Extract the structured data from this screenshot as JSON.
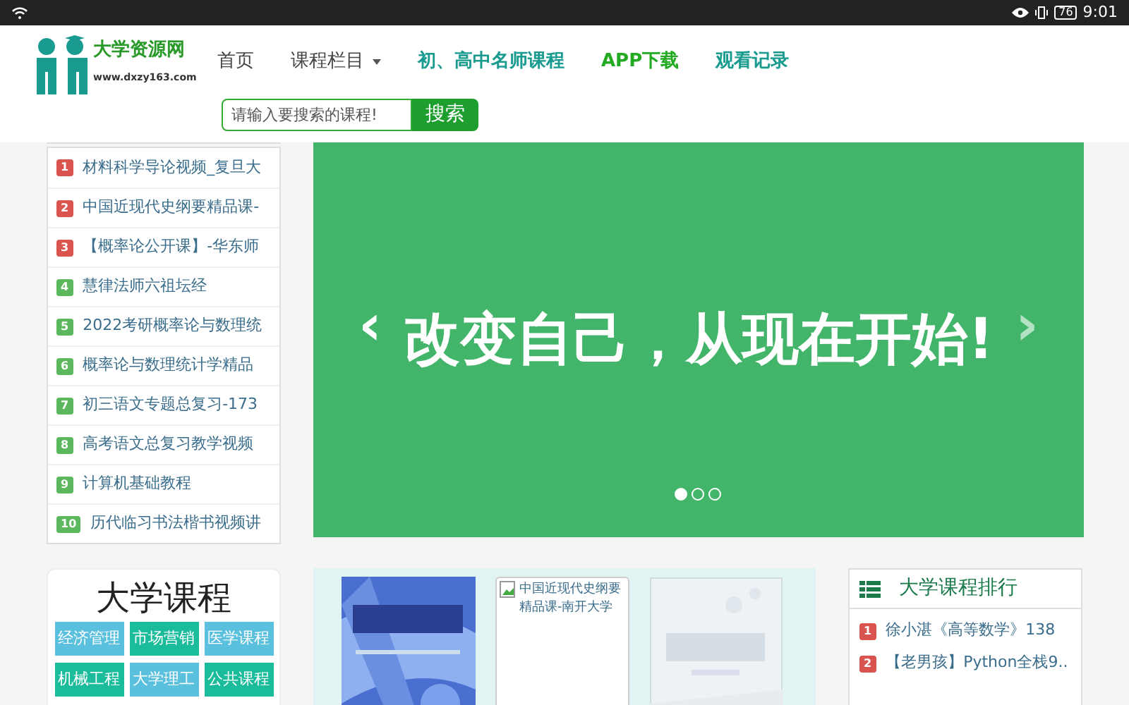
{
  "status_bar": {
    "time": "9:01",
    "battery": "76"
  },
  "site": {
    "name": "大学资源网",
    "url": "www.dxzy163.com"
  },
  "nav": [
    {
      "label": "首页",
      "kind": "plain",
      "dropdown": false
    },
    {
      "label": "课程栏目",
      "kind": "plain",
      "dropdown": true
    },
    {
      "label": "初、高中名师课程",
      "kind": "teal",
      "dropdown": false
    },
    {
      "label": "APP下载",
      "kind": "green",
      "dropdown": false
    },
    {
      "label": "观看记录",
      "kind": "teal",
      "dropdown": false
    }
  ],
  "search": {
    "placeholder": "请输入要搜索的课程!",
    "button": "搜索"
  },
  "hot_list": [
    {
      "rank": "1",
      "title": "材料科学导论视频_复旦大",
      "color": "#d9534f"
    },
    {
      "rank": "2",
      "title": "中国近现代史纲要精品课-",
      "color": "#d9534f"
    },
    {
      "rank": "3",
      "title": "【概率论公开课】-华东师",
      "color": "#d9534f"
    },
    {
      "rank": "4",
      "title": "慧律法师六祖坛经",
      "color": "#5cb85c"
    },
    {
      "rank": "5",
      "title": "2022考研概率论与数理统",
      "color": "#5cb85c"
    },
    {
      "rank": "6",
      "title": "概率论与数理统计学精品",
      "color": "#5cb85c"
    },
    {
      "rank": "7",
      "title": "初三语文专题总复习-173",
      "color": "#5cb85c"
    },
    {
      "rank": "8",
      "title": "高考语文总复习教学视频",
      "color": "#5cb85c"
    },
    {
      "rank": "9",
      "title": "计算机基础教程",
      "color": "#5cb85c"
    },
    {
      "rank": "10",
      "title": "历代临习书法楷书视频讲",
      "color": "#5cb85c"
    }
  ],
  "carousel": {
    "caption": "改变自己，从现在开始!",
    "prev": "‹",
    "next": "›",
    "dots": [
      {
        "selected": true
      },
      {
        "selected": false
      },
      {
        "selected": false
      }
    ]
  },
  "categories": {
    "title": "大学课程",
    "items": [
      {
        "label": "经济管理",
        "color": "#5bc0de"
      },
      {
        "label": "市场营销",
        "color": "#1abc9c"
      },
      {
        "label": "医学课程",
        "color": "#5bc0de"
      },
      {
        "label": "机械工程",
        "color": "#1abc9c"
      },
      {
        "label": "大学理工",
        "color": "#5bc0de"
      },
      {
        "label": "公共课程",
        "color": "#1abc9c"
      }
    ]
  },
  "books": [
    {
      "kind": "picture"
    },
    {
      "kind": "broken",
      "alt": "中国近现代史纲要精品课-南开大学"
    },
    {
      "kind": "picture"
    }
  ],
  "ranking": {
    "title": "大学课程排行",
    "items": [
      {
        "rank": "1",
        "title": "徐小湛《高等数学》138",
        "color": "#d9534f"
      },
      {
        "rank": "2",
        "title": "【老男孩】Python全栈9..",
        "color": "#d9534f"
      }
    ]
  }
}
